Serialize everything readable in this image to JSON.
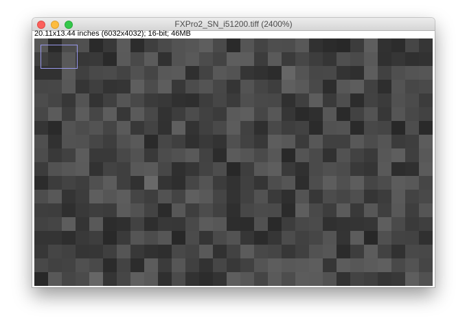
{
  "window": {
    "title": "FXPro2_SN_i51200.tiff (2400%)",
    "info": "20.11x13.44 inches (6032x4032); 16-bit; 46MB"
  },
  "traffic_lights": {
    "close_color": "#fc605c",
    "close_border": "#de4a45",
    "minimize_color": "#fdbc40",
    "minimize_border": "#dea031",
    "zoom_color": "#34c84a",
    "zoom_border": "#27a93a"
  },
  "canvas": {
    "zoom": "2400%",
    "navigator_color": "#9999ee"
  }
}
